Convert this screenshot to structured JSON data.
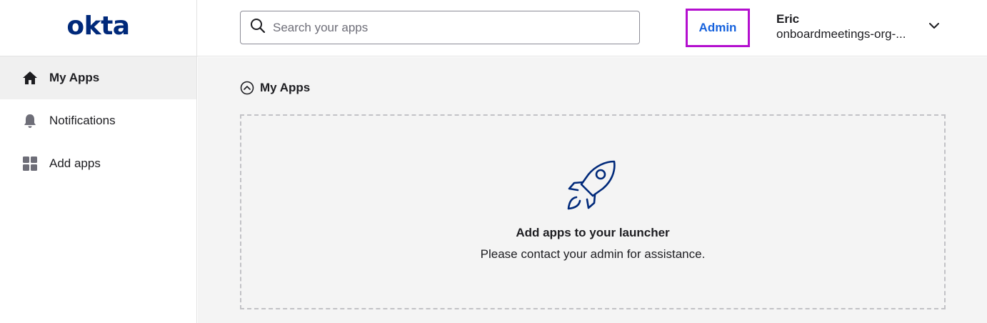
{
  "brand": {
    "logo_text": "okta",
    "logo_color": "#00297a"
  },
  "sidebar": {
    "items": [
      {
        "label": "My Apps",
        "icon": "home-icon",
        "active": true
      },
      {
        "label": "Notifications",
        "icon": "bell-icon",
        "active": false
      },
      {
        "label": "Add apps",
        "icon": "grid-icon",
        "active": false
      }
    ]
  },
  "header": {
    "search": {
      "placeholder": "Search your apps",
      "value": ""
    },
    "admin_label": "Admin",
    "admin_highlight_color": "#b40fcf",
    "user": {
      "name": "Eric",
      "org": "onboardmeetings-org-..."
    }
  },
  "main": {
    "section_title": "My Apps",
    "empty_state": {
      "icon": "rocket-icon",
      "title": "Add apps to your launcher",
      "subtitle": "Please contact your admin for assistance."
    }
  },
  "colors": {
    "accent": "#1662dd",
    "nav_active_bg": "#f0f0f0",
    "main_bg": "#f4f4f4"
  }
}
